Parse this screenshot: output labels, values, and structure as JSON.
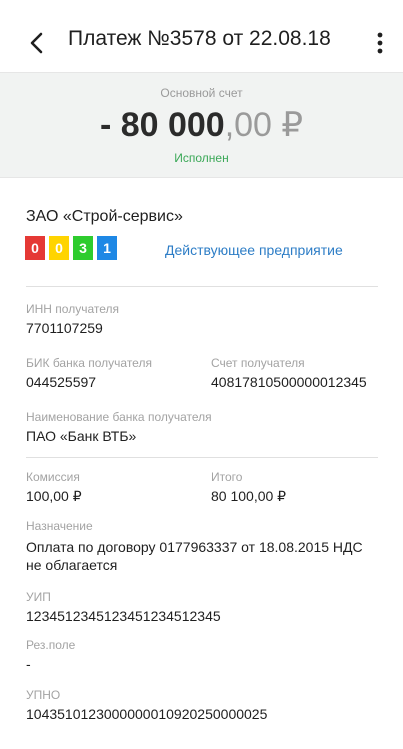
{
  "header": {
    "title": "Платеж №3578 от 22.08.18",
    "back_icon": "chevron-left-icon",
    "menu_icon": "more-vertical-icon"
  },
  "summary": {
    "account_label": "Основной счет",
    "amount_whole": "- 80 000",
    "amount_fraction": ",00",
    "currency": " ₽",
    "status": "Исполнен",
    "status_color": "#3aa857"
  },
  "payee": {
    "name": "ЗАО «Строй-сервис»",
    "badges": [
      {
        "value": "0",
        "color": "#e53935"
      },
      {
        "value": "0",
        "color": "#ffd400"
      },
      {
        "value": "3",
        "color": "#2ecc2e"
      },
      {
        "value": "1",
        "color": "#1e88e5"
      }
    ],
    "company_status": "Действующее предприятие"
  },
  "details": {
    "inn_label": "ИНН получателя",
    "inn_value": "7701107259",
    "bik_label": "БИК банка получателя",
    "bik_value": "044525597",
    "account_label": "Счет получателя",
    "account_value": "40817810500000012345",
    "bank_label": "Наименование банка получателя",
    "bank_value": "ПАО «Банк ВТБ»",
    "commission_label": "Комиссия",
    "commission_value": "100,00 ₽",
    "total_label": "Итого",
    "total_value": "80 100,00 ₽",
    "purpose_label": "Назначение",
    "purpose_value": "Оплата по договору 0177963337 от 18.08.2015 НДС не облагается",
    "uip_label": "УИП",
    "uip_value": "1234512345123451234512345",
    "reserve_label": "Рез.поле",
    "reserve_value": "-",
    "upno_label": "УПНО",
    "upno_value": "1043510123000000010920250000025"
  }
}
